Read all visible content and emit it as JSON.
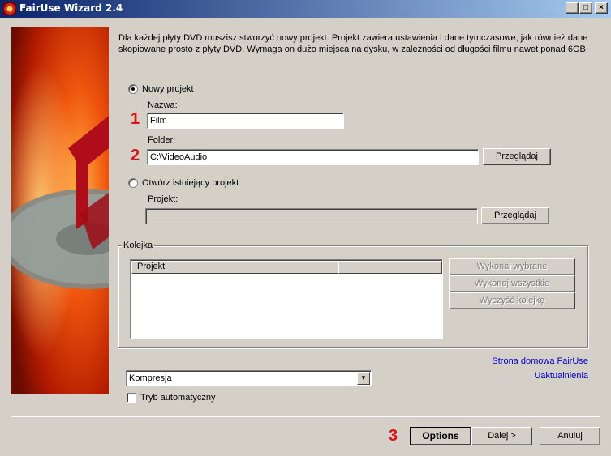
{
  "window": {
    "title": "FairUse Wizard 2.4",
    "controls": {
      "minimize": "_",
      "maximize": "□",
      "close": "×"
    }
  },
  "intro": "Dla każdej płyty DVD muszisz stworzyć nowy projekt. Projekt zawiera ustawienia i dane tymczasowe, jak również dane skopiowane prosto z płyty DVD. Wymaga on dużo miejsca na dysku, w zależności od długości filmu nawet ponad 6GB.",
  "new_project": {
    "radio_label": "Nowy projekt",
    "selected": true,
    "name_label": "Nazwa:",
    "name_value": "Film",
    "folder_label": "Folder:",
    "folder_value": "C:\\VideoAudio",
    "browse_label": "Przeglądaj"
  },
  "open_project": {
    "radio_label": "Otwórz istniejący projekt",
    "selected": false,
    "project_label": "Projekt:",
    "project_value": "",
    "browse_label": "Przeglądaj"
  },
  "queue": {
    "title": "Kolejka",
    "columns": [
      "Projekt",
      ""
    ],
    "buttons": {
      "run_selected": "Wykonaj wybrane",
      "run_all": "Wykonaj wszystkie",
      "clear_queue": "Wyczyść kolejkę"
    }
  },
  "links": {
    "homepage": "Strona domowa FairUse",
    "update": "Uaktualnienia"
  },
  "mode_select": {
    "value": "Kompresja"
  },
  "auto_mode": {
    "label": "Tryb automatyczny",
    "checked": false
  },
  "footer": {
    "options": "Options",
    "next": "Dalej >",
    "cancel": "Anuluj"
  },
  "markers": {
    "m1": "1",
    "m2": "2",
    "m3": "3"
  },
  "colors": {
    "title_start": "#0a246a",
    "title_end": "#a6caf0",
    "marker": "#dd1111",
    "link": "#0000cc"
  },
  "icons": {
    "app": "fairuse-app-icon",
    "dropdown": "chevron-down-icon"
  }
}
